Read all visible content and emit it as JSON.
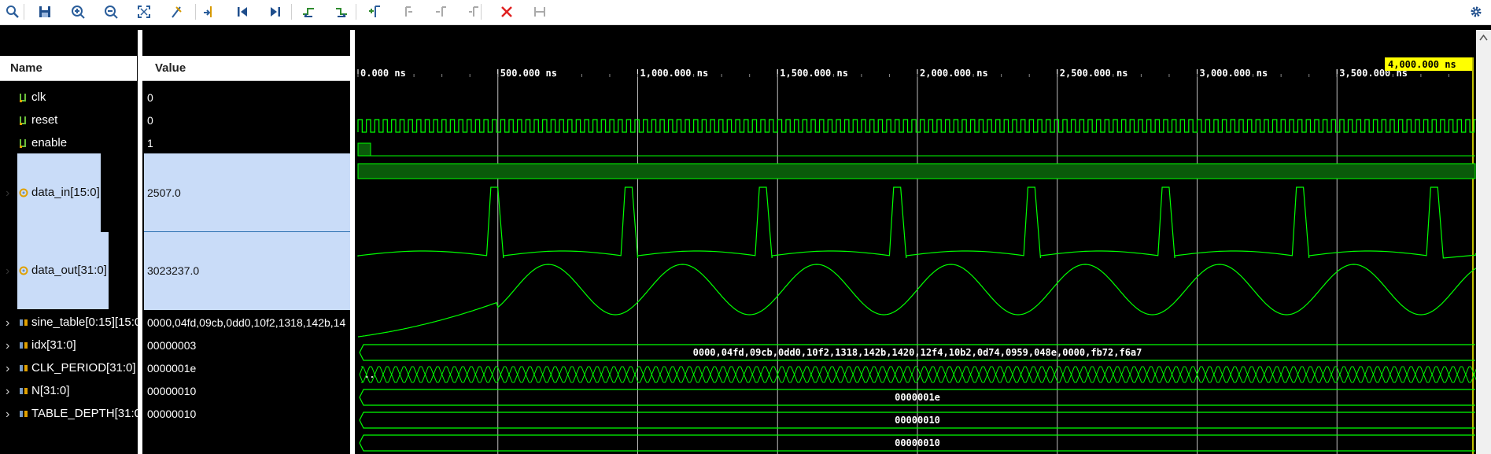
{
  "toolbar": {
    "buttons": [
      "search-icon",
      "save-icon",
      "zoom-in-icon",
      "zoom-out-icon",
      "zoom-fit-icon",
      "swap-cursor-icon",
      "goto-cursor-icon",
      "go-to-start-icon",
      "go-to-end-icon",
      "previous-transition-icon",
      "next-transition-icon",
      "add-marker-icon",
      "previous-marker-icon",
      "next-marker-icon",
      "swap-markers-icon",
      "delete-icon",
      "marker-range-icon"
    ],
    "settings": "gear-icon"
  },
  "headers": {
    "name": "Name",
    "value": "Value"
  },
  "signals": [
    {
      "name": "clk",
      "value": "0",
      "type": "bit"
    },
    {
      "name": "reset",
      "value": "0",
      "type": "bit"
    },
    {
      "name": "enable",
      "value": "1",
      "type": "bit"
    },
    {
      "name": "data_in[15:0]",
      "value": "2507.0",
      "type": "analog"
    },
    {
      "name": "data_out[31:0]",
      "value": "3023237.0",
      "type": "analog"
    },
    {
      "name": "sine_table[0:15][15:0",
      "value": "0000,04fd,09cb,0dd0,10f2,1318,142b,14",
      "type": "bus"
    },
    {
      "name": "idx[31:0]",
      "value": "00000003",
      "type": "bus"
    },
    {
      "name": "CLK_PERIOD[31:0]",
      "value": "0000001e",
      "type": "bus"
    },
    {
      "name": "N[31:0]",
      "value": "00000010",
      "type": "bus"
    },
    {
      "name": "TABLE_DEPTH[31:0]",
      "value": "00000010",
      "type": "bus"
    }
  ],
  "timeline": {
    "ticks": [
      "0.000 ns",
      "500.000 ns",
      "1,000.000 ns",
      "1,500.000 ns",
      "2,000.000 ns",
      "2,500.000 ns",
      "3,000.000 ns",
      "3,500.000 ns"
    ],
    "cursor_label": "4,000.000 ns"
  },
  "bus_labels": {
    "sine_table": "0000,04fd,09cb,0dd0,10f2,1318,142b,1420,12f4,10b2,0d74,0959,048e,0000,fb72,f6a7",
    "idx_first": "..",
    "clk_period": "0000001e",
    "n": "00000010",
    "table_depth": "00000010"
  },
  "colors": {
    "wave": "#00ff00",
    "selection": "#c9dcf8",
    "cursor": "#ffff00",
    "grid": "#c0c0c0"
  }
}
